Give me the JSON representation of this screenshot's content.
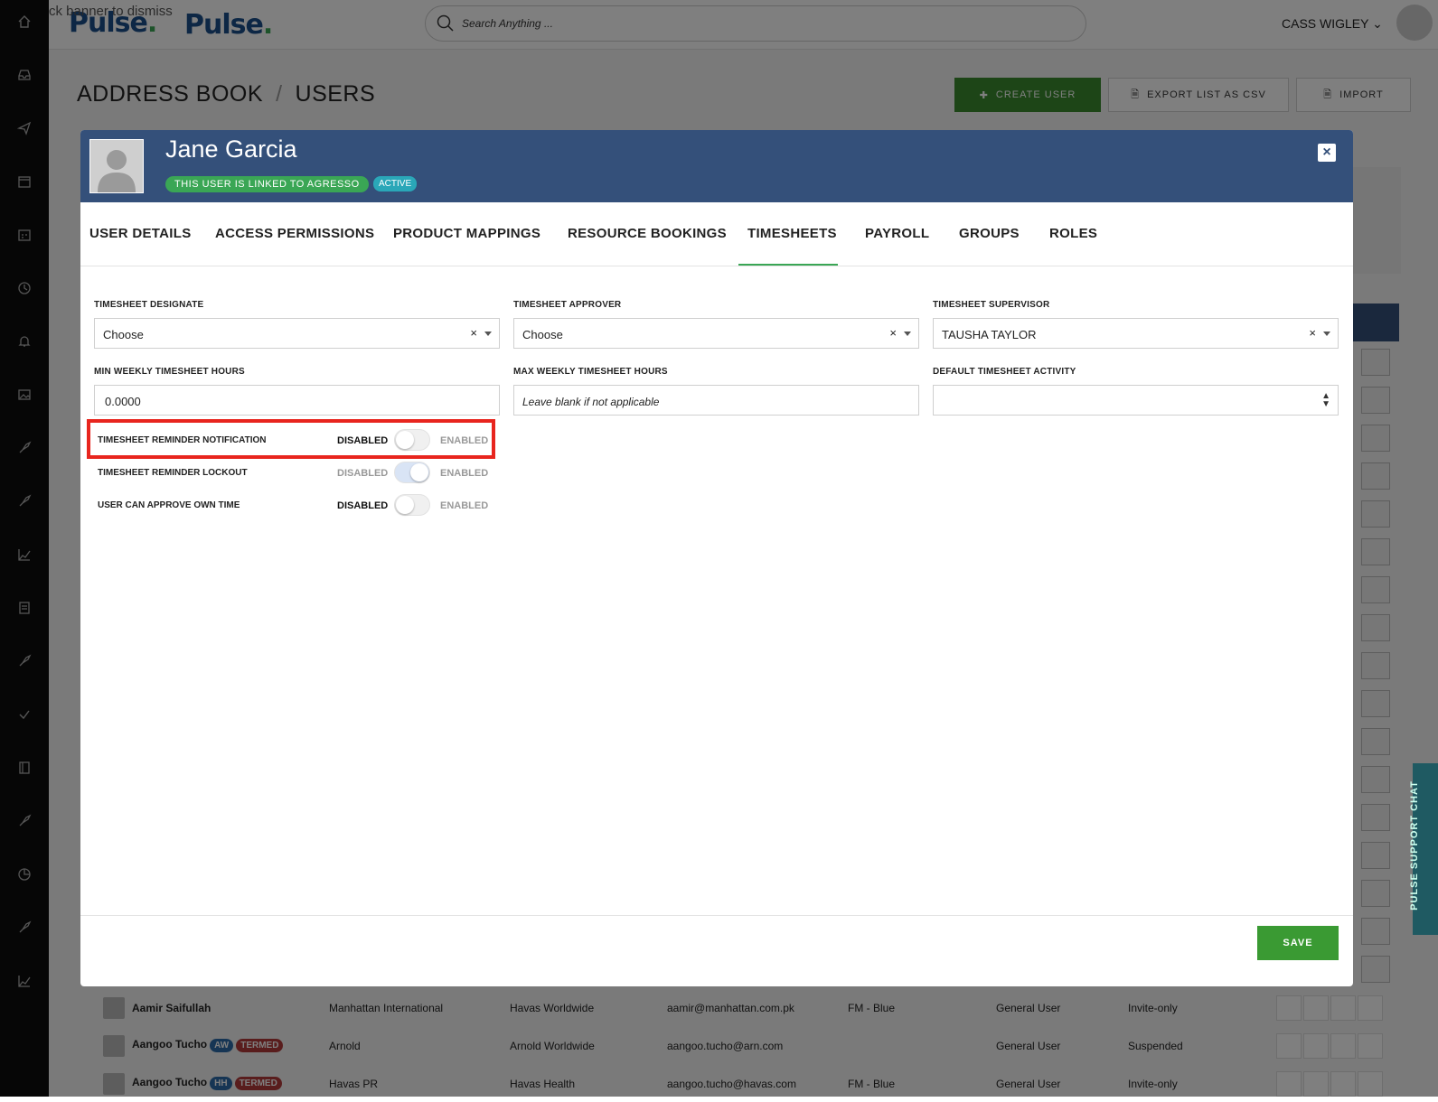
{
  "app": {
    "banner": "ck banner to dismiss",
    "logo_primary": "Pulse",
    "logo_secondary": "Pulse",
    "logo_dot": "."
  },
  "search": {
    "placeholder": "Search Anything ..."
  },
  "user_menu": {
    "name": "CASS WIGLEY"
  },
  "breadcrumb": {
    "section": "ADDRESS BOOK",
    "separator": "/",
    "page": "USERS"
  },
  "toolbar": {
    "create_label": "CREATE USER",
    "export_label": "EXPORT LIST AS CSV",
    "import_label": "IMPORT"
  },
  "background_rows": [
    {
      "name": "Aamir Saifullah",
      "tags": [],
      "company": "Manhattan International",
      "agency": "Havas Worldwide",
      "email": "aamir@manhattan.com.pk",
      "team": "FM - Blue",
      "role": "General User",
      "status": "Invite-only"
    },
    {
      "name": "Aangoo Tucho",
      "tags": [
        {
          "text": "AW",
          "kind": "blue"
        },
        {
          "text": "TERMED",
          "kind": "red"
        }
      ],
      "company": "Arnold",
      "agency": "Arnold Worldwide",
      "email": "aangoo.tucho@arn.com",
      "team": "",
      "role": "General User",
      "status": "Suspended"
    },
    {
      "name": "Aangoo Tucho",
      "tags": [
        {
          "text": "HH",
          "kind": "blue"
        },
        {
          "text": "TERMED",
          "kind": "red"
        }
      ],
      "company": "Havas PR",
      "agency": "Havas Health",
      "email": "aangoo.tucho@havas.com",
      "team": "FM - Blue",
      "role": "General User",
      "status": "Invite-only"
    }
  ],
  "support_chat": {
    "label": "PULSE SUPPORT CHAT"
  },
  "modal": {
    "title": "Jane Garcia",
    "linked_badge": "THIS USER IS LINKED TO AGRESSO",
    "status_badge": "ACTIVE",
    "close_label": "×",
    "tabs": [
      {
        "label": "USER DETAILS"
      },
      {
        "label": "ACCESS PERMISSIONS"
      },
      {
        "label": "PRODUCT MAPPINGS"
      },
      {
        "label": "RESOURCE BOOKINGS"
      },
      {
        "label": "TIMESHEETS",
        "active": true
      },
      {
        "label": "PAYROLL"
      },
      {
        "label": "GROUPS"
      },
      {
        "label": "ROLES"
      }
    ],
    "fields": {
      "designate": {
        "label": "TIMESHEET DESIGNATE",
        "value": "Choose",
        "clear": "×"
      },
      "approver": {
        "label": "TIMESHEET APPROVER",
        "value": "Choose",
        "clear": "×"
      },
      "supervisor": {
        "label": "TIMESHEET SUPERVISOR",
        "value": "TAUSHA TAYLOR",
        "clear": "×"
      },
      "min_hours": {
        "label": "MIN WEEKLY TIMESHEET HOURS",
        "value": "0.0000"
      },
      "max_hours": {
        "label": "MAX WEEKLY TIMESHEET HOURS",
        "placeholder": "Leave blank if not applicable"
      },
      "default_activity": {
        "label": "DEFAULT TIMESHEET ACTIVITY",
        "value": ""
      }
    },
    "toggles": [
      {
        "label": "TIMESHEET REMINDER NOTIFICATION",
        "off_label": "DISABLED",
        "on_label": "ENABLED",
        "enabled": false
      },
      {
        "label": "TIMESHEET REMINDER LOCKOUT",
        "off_label": "DISABLED",
        "on_label": "ENABLED",
        "enabled": true
      },
      {
        "label": "USER CAN APPROVE OWN TIME",
        "off_label": "DISABLED",
        "on_label": "ENABLED",
        "enabled": false
      }
    ],
    "save_label": "SAVE"
  },
  "colors": {
    "header": "#34507a",
    "accent_green": "#3a9a33",
    "badge_active": "#2aa7b8",
    "highlight": "#e8251e"
  }
}
